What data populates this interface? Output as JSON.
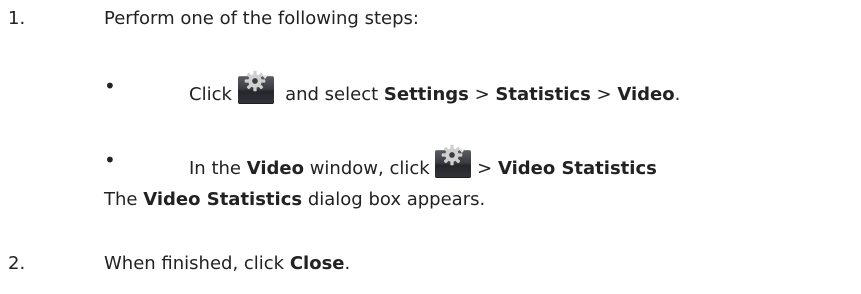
{
  "steps": [
    {
      "number": "1.",
      "text": "Perform one of the following steps:",
      "options": [
        {
          "pre": "Click",
          "icon": "gear-settings-icon",
          "mid": "and select",
          "path": [
            "Settings",
            "Statistics",
            "Video"
          ],
          "sep": ">",
          "end": "."
        },
        {
          "pre": "In the",
          "window": "Video",
          "mid": "window, click",
          "icon": "gear-settings-icon",
          "sep": ">",
          "target": "Video Statistics"
        }
      ],
      "result": {
        "pre": "The",
        "name": "Video Statistics",
        "post": "dialog box appears."
      }
    },
    {
      "number": "2.",
      "pre": "When finished, click",
      "target": "Close",
      "end": "."
    }
  ],
  "bullet_char": "•",
  "colors": {
    "text": "#222222",
    "button_top": "#5a5c63",
    "button_bottom": "#25262b",
    "gear": "#d0d0d0"
  }
}
